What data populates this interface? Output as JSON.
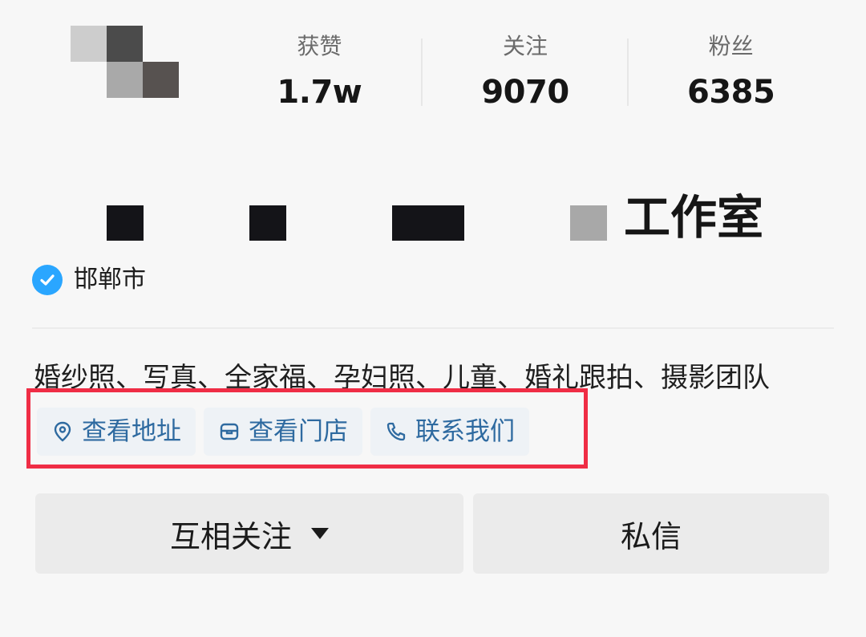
{
  "profile": {
    "avatar_alt": "",
    "stats": [
      {
        "label": "获赞",
        "value": "1.7w"
      },
      {
        "label": "关注",
        "value": "9070"
      },
      {
        "label": "粉丝",
        "value": "6385"
      }
    ],
    "name_visible": "工作室",
    "verified_icon": "check-badge-icon",
    "city": "邯郸市",
    "bio": "婚纱照、写真、全家福、孕妇照、儿童、婚礼跟拍、摄影团队",
    "tags": [
      {
        "icon": "location-pin-icon",
        "label": "查看地址"
      },
      {
        "icon": "store-icon",
        "label": "查看门店"
      },
      {
        "icon": "phone-icon",
        "label": "联系我们"
      }
    ]
  },
  "actions": {
    "follow_label": "互相关注",
    "message_label": "私信"
  },
  "colors": {
    "accent_blue": "#2e6aa0",
    "verify_blue": "#2aa6ff",
    "highlight_red": "#ef2d45",
    "button_bg": "#ebebeb"
  }
}
